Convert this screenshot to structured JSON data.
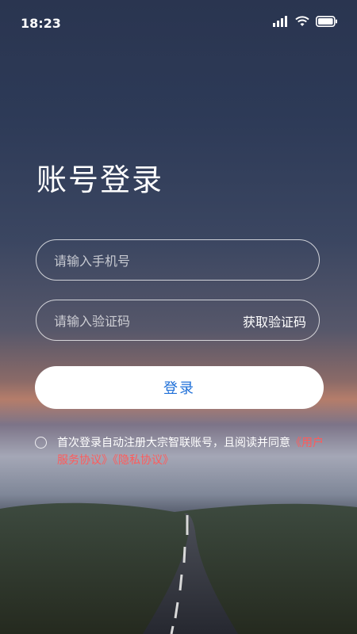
{
  "status_bar": {
    "time": "18:23",
    "icons": [
      "signal-icon",
      "wifi-icon",
      "battery-icon"
    ]
  },
  "page": {
    "title": "账号登录"
  },
  "form": {
    "phone_placeholder": "请输入手机号",
    "code_placeholder": "请输入验证码",
    "get_code_label": "获取验证码",
    "login_label": "登录"
  },
  "agreement": {
    "text": "首次登录自动注册大宗智联账号，且阅读并同意",
    "user_agreement": "《用户服务协议》",
    "privacy_policy": "《隐私协议》"
  },
  "colors": {
    "accent": "#1e6fd8",
    "link": "#ff5b5b"
  }
}
